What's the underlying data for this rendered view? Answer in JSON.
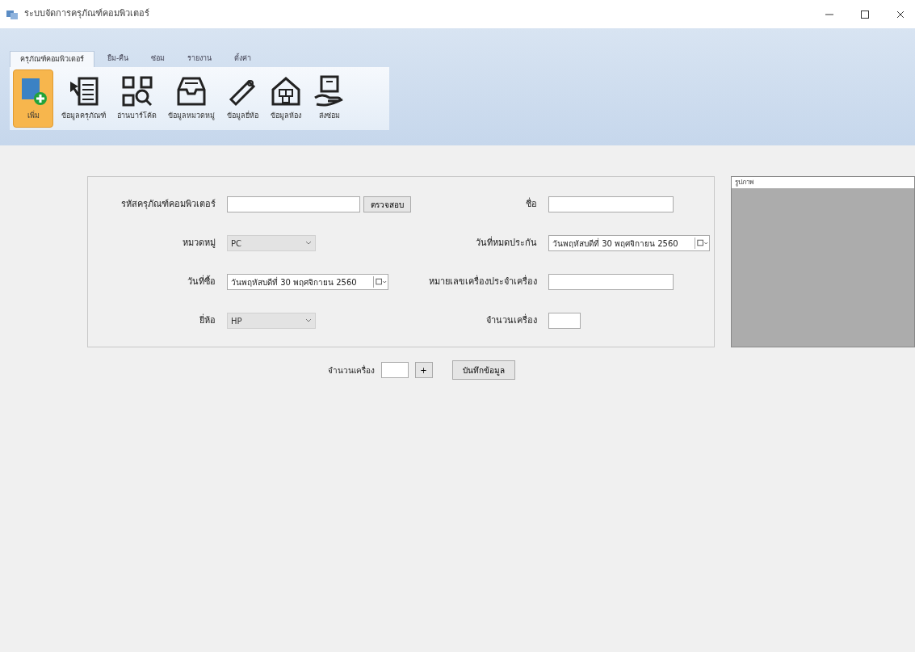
{
  "window": {
    "title": "ระบบจัดการครุภัณฑ์คอมพิวเตอร์"
  },
  "tabs": [
    {
      "label": "ครุภัณฑ์คอมพิวเตอร์",
      "selected": true
    },
    {
      "label": "ยืม-คืน",
      "selected": false
    },
    {
      "label": "ซ่อม",
      "selected": false
    },
    {
      "label": "รายงาน",
      "selected": false
    },
    {
      "label": "ตั้งค่า",
      "selected": false
    }
  ],
  "ribbon": [
    {
      "label": "เพิ่ม",
      "kind": "add",
      "selected": true
    },
    {
      "label": "ข้อมูลครุภัณฑ์",
      "kind": "list",
      "selected": false
    },
    {
      "label": "อ่านบาร์โค้ด",
      "kind": "qr",
      "selected": false
    },
    {
      "label": "ข้อมูลหมวดหมู่",
      "kind": "tray",
      "selected": false
    },
    {
      "label": "ข้อมูลยี่ห้อ",
      "kind": "tag",
      "selected": false
    },
    {
      "label": "ข้อมูลห้อง",
      "kind": "house",
      "selected": false
    },
    {
      "label": "ส่งซ่อม",
      "kind": "hand",
      "selected": false
    }
  ],
  "form": {
    "left": [
      {
        "label": "รหัสครุภัณฑ์คอมพิวเตอร์",
        "kind": "text",
        "button": "ตรวจสอบ"
      },
      {
        "label": "หมวดหมู่",
        "kind": "combo",
        "value": "PC"
      },
      {
        "label": "วันที่ซื้อ",
        "kind": "date",
        "value": "วันพฤหัสบดีที่ 30 พฤศจิกายน 2560"
      },
      {
        "label": "ยี่ห้อ",
        "kind": "combo",
        "value": "HP"
      }
    ],
    "right": [
      {
        "label": "ชื่อ",
        "kind": "text"
      },
      {
        "label": "วันที่หมดประกัน",
        "kind": "date",
        "value": "วันพฤหัสบดีที่ 30 พฤศจิกายน 2560"
      },
      {
        "label": "หมายเลขเครื่องประจำเครื่อง",
        "kind": "text"
      },
      {
        "label": "จำนวนเครื่อง",
        "kind": "small"
      }
    ]
  },
  "footer": {
    "label": "จำนวนเครื่อง",
    "add_button": "+",
    "save_button": "บันทึกข้อมูล"
  },
  "picture_panel": {
    "title": "รูปภาพ"
  }
}
